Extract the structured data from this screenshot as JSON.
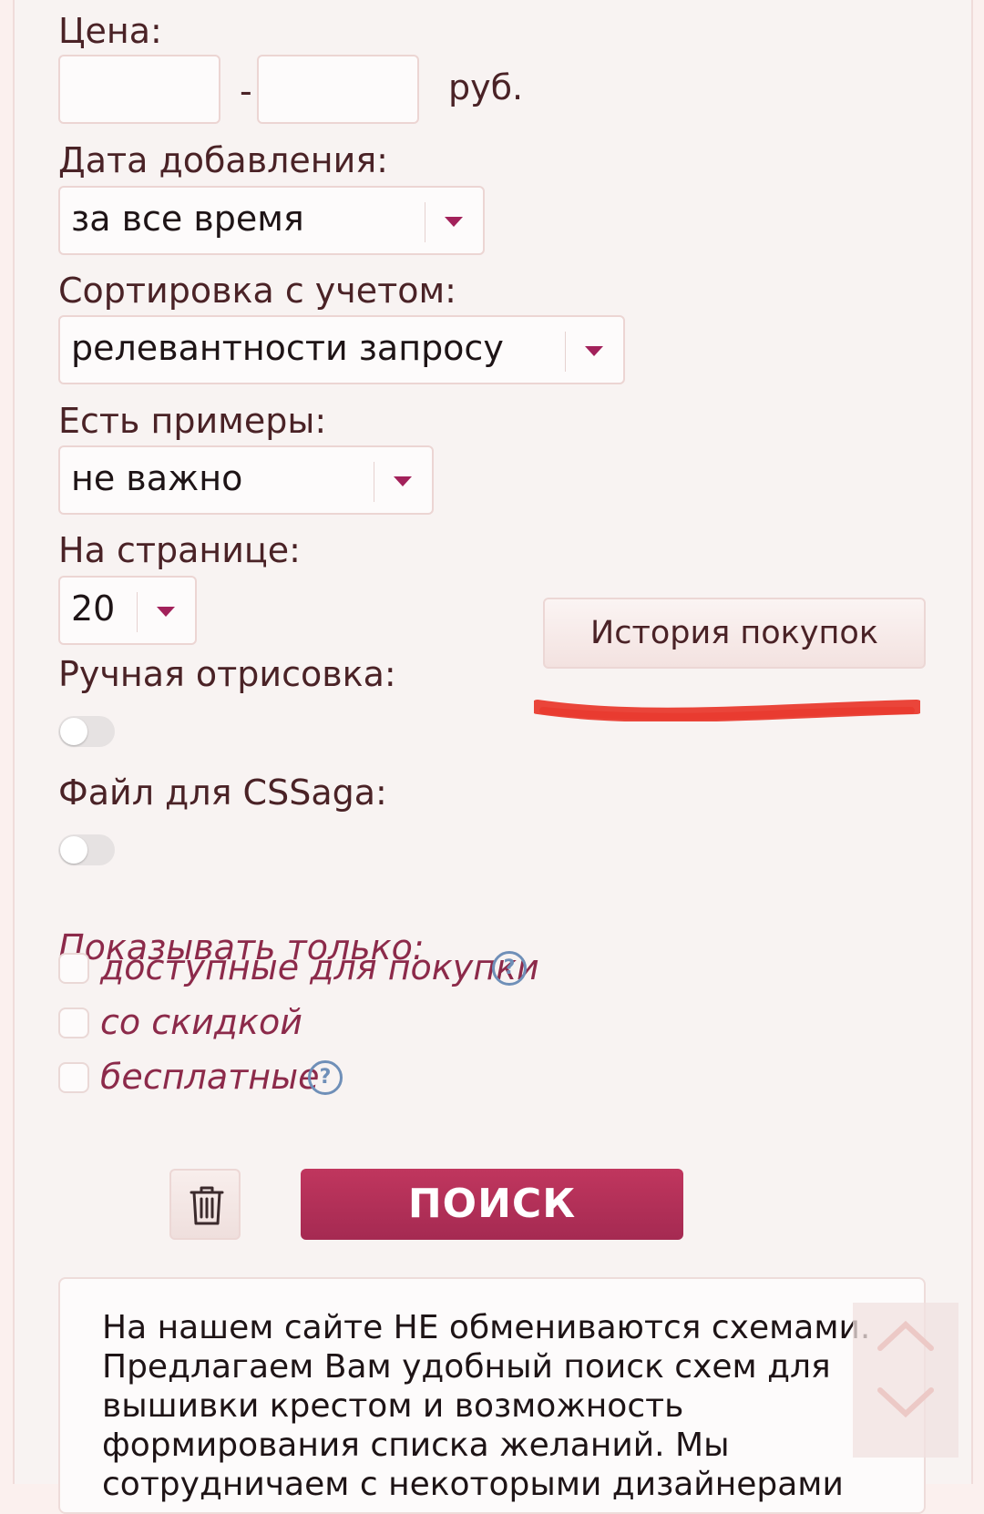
{
  "filters": {
    "price": {
      "label": "Цена:",
      "min_value": "",
      "max_value": "",
      "separator": "-",
      "currency": "руб."
    },
    "date_added": {
      "label": "Дата добавления:",
      "selected": "за все время"
    },
    "sort_by": {
      "label": "Сортировка с учетом:",
      "selected": "релевантности запросу"
    },
    "has_examples": {
      "label": "Есть примеры:",
      "selected": "не важно"
    },
    "per_page": {
      "label": "На странице:",
      "selected": "20"
    },
    "manual_drawing": {
      "label": "Ручная отрисовка:",
      "enabled": false
    },
    "cssaga_file": {
      "label": "Файл для CSSaga:",
      "enabled": false
    }
  },
  "purchase_history_button": "История покупок",
  "show_only": {
    "label": "Показывать только:",
    "options": [
      {
        "label": "доступные для покупки",
        "checked": false,
        "help": "?"
      },
      {
        "label": "со скидкой",
        "checked": false
      },
      {
        "label": "бесплатные",
        "checked": false,
        "help": "?"
      }
    ]
  },
  "actions": {
    "search_label": "ПОИСК",
    "clear_icon": "trash-icon"
  },
  "info_text": "На нашем сайте НЕ обмениваются схемами. Предлагаем Вам удобный поиск схем для вышивки крестом и возможность формирования списка желаний. Мы сотрудничаем с некоторыми дизайнерами",
  "colors": {
    "accent": "#a52a52",
    "label_italic": "#8c2a4a",
    "help_icon": "#6f8fb8",
    "scribble": "#e8362a"
  }
}
